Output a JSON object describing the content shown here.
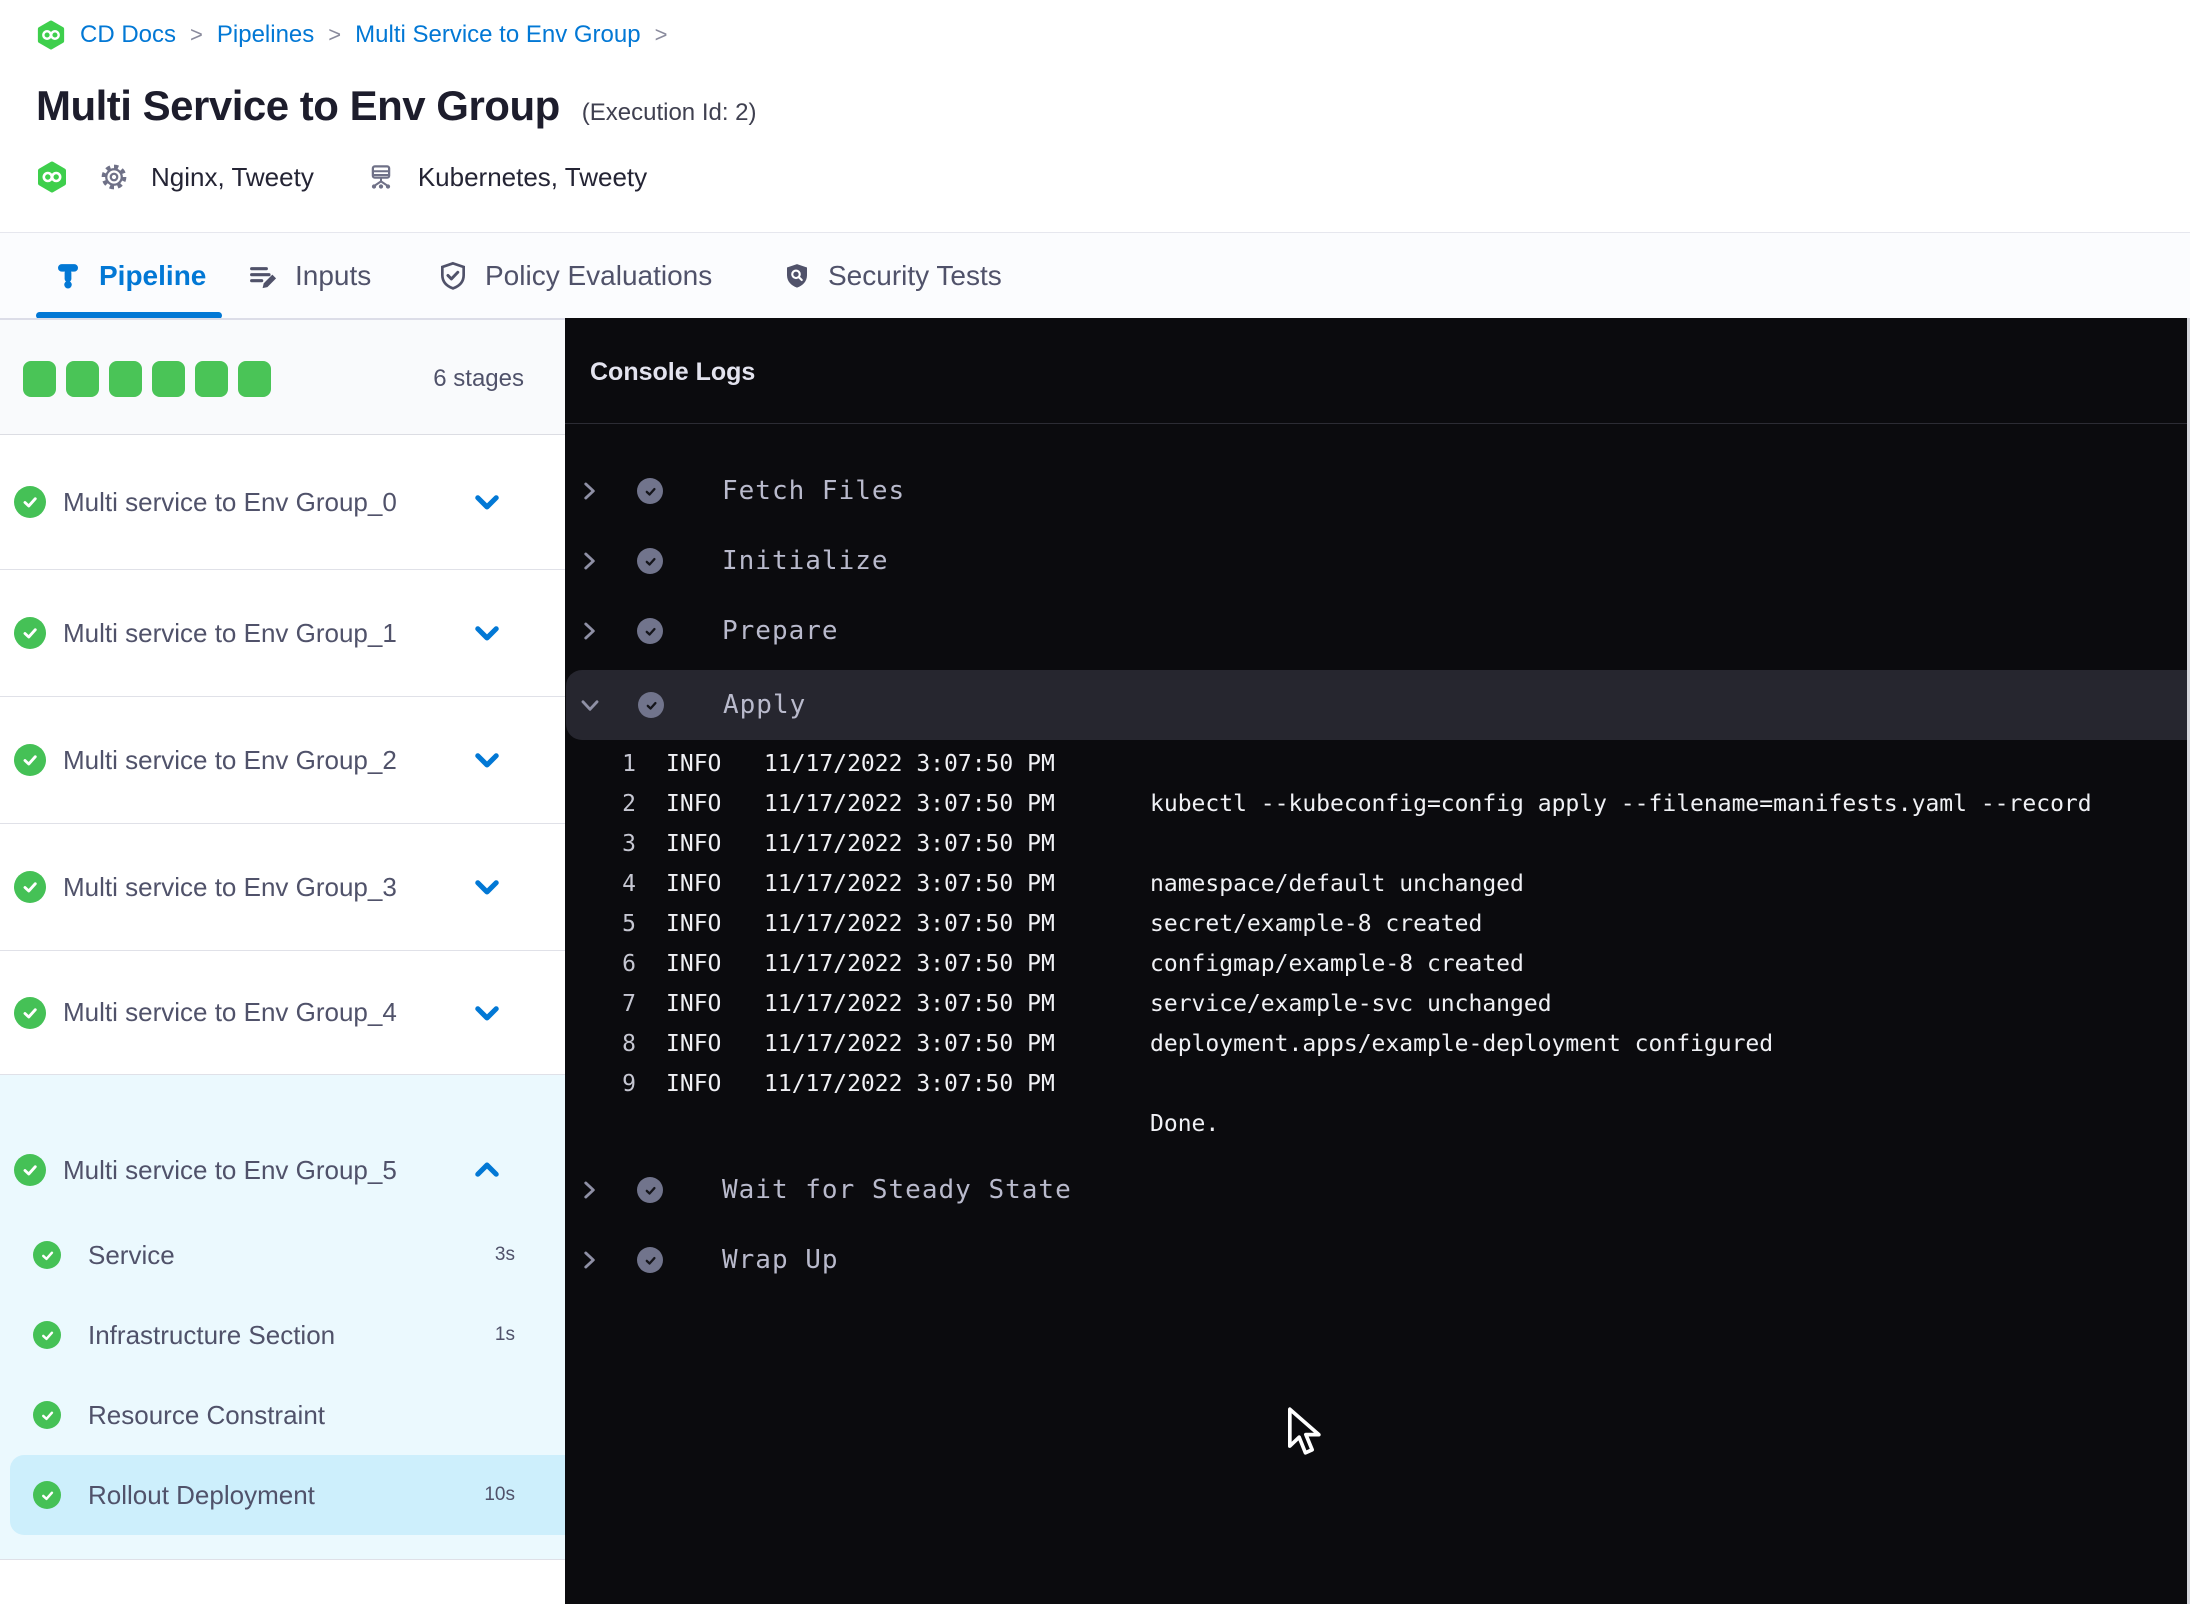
{
  "breadcrumb": {
    "separator": ">",
    "items": [
      {
        "label": "CD Docs"
      },
      {
        "label": "Pipelines"
      },
      {
        "label": "Multi Service to Env Group"
      }
    ]
  },
  "header": {
    "title": "Multi Service to Env Group",
    "execution_id": "(Execution Id: 2)",
    "services_label": "Nginx, Tweety",
    "environments_label": "Kubernetes, Tweety"
  },
  "tabs": [
    {
      "label": "Pipeline",
      "active": true
    },
    {
      "label": "Inputs",
      "active": false
    },
    {
      "label": "Policy Evaluations",
      "active": false
    },
    {
      "label": "Security Tests",
      "active": false
    }
  ],
  "stages": {
    "count_label": "6 stages",
    "items": [
      {
        "label": "Multi service to Env Group_0",
        "status": "success",
        "expanded": false
      },
      {
        "label": "Multi service to Env Group_1",
        "status": "success",
        "expanded": false
      },
      {
        "label": "Multi service to Env Group_2",
        "status": "success",
        "expanded": false
      },
      {
        "label": "Multi service to Env Group_3",
        "status": "success",
        "expanded": false
      },
      {
        "label": "Multi service to Env Group_4",
        "status": "success",
        "expanded": false
      },
      {
        "label": "Multi service to Env Group_5",
        "status": "success",
        "expanded": true
      }
    ],
    "expanded_steps": [
      {
        "label": "Service",
        "duration": "3s",
        "status": "success",
        "selected": false
      },
      {
        "label": "Infrastructure Section",
        "duration": "1s",
        "status": "success",
        "selected": false
      },
      {
        "label": "Resource Constraint",
        "duration": "",
        "status": "success",
        "selected": false
      },
      {
        "label": "Rollout Deployment",
        "duration": "10s",
        "status": "success",
        "selected": true
      }
    ]
  },
  "console": {
    "title": "Console Logs",
    "steps": [
      {
        "label": "Fetch Files",
        "status": "success",
        "expanded": false
      },
      {
        "label": "Initialize",
        "status": "success",
        "expanded": false
      },
      {
        "label": "Prepare",
        "status": "success",
        "expanded": false
      },
      {
        "label": "Apply",
        "status": "success",
        "expanded": true
      },
      {
        "label": "Wait for Steady State",
        "status": "success",
        "expanded": false
      },
      {
        "label": "Wrap Up",
        "status": "success",
        "expanded": false
      }
    ],
    "logs": [
      {
        "num": "1",
        "level": "INFO",
        "time": "11/17/2022 3:07:50 PM",
        "msg": ""
      },
      {
        "num": "2",
        "level": "INFO",
        "time": "11/17/2022 3:07:50 PM",
        "msg": "kubectl --kubeconfig=config apply --filename=manifests.yaml --record"
      },
      {
        "num": "3",
        "level": "INFO",
        "time": "11/17/2022 3:07:50 PM",
        "msg": ""
      },
      {
        "num": "4",
        "level": "INFO",
        "time": "11/17/2022 3:07:50 PM",
        "msg": "namespace/default unchanged"
      },
      {
        "num": "5",
        "level": "INFO",
        "time": "11/17/2022 3:07:50 PM",
        "msg": "secret/example-8 created"
      },
      {
        "num": "6",
        "level": "INFO",
        "time": "11/17/2022 3:07:50 PM",
        "msg": "configmap/example-8 created"
      },
      {
        "num": "7",
        "level": "INFO",
        "time": "11/17/2022 3:07:50 PM",
        "msg": "service/example-svc unchanged"
      },
      {
        "num": "8",
        "level": "INFO",
        "time": "11/17/2022 3:07:50 PM",
        "msg": "deployment.apps/example-deployment configured"
      },
      {
        "num": "9",
        "level": "INFO",
        "time": "11/17/2022 3:07:50 PM",
        "msg": ""
      },
      {
        "num": "",
        "level": "",
        "time": "",
        "msg": "Done."
      }
    ]
  },
  "icons": {
    "harness-logo": "green hexagon with white infinity",
    "gear-icon": "cog outline",
    "environment-icon": "database rack with legs",
    "pipeline-icon": "plumb pipeline glyph",
    "inputs-icon": "list lines with pencil",
    "policy-icon": "shield outline with check",
    "security-icon": "filled shield with magnifier",
    "check-circle-icon": "circle with check",
    "chevron-down-icon": "v",
    "chevron-up-icon": "^",
    "chevron-right-icon": ">"
  },
  "colors": {
    "accent_blue": "#0278d5",
    "success_green": "#4ac457",
    "console_bg": "#0b0b0e",
    "console_highlight": "#26262f",
    "expanded_bg": "#ebf9fe",
    "selected_step_bg": "#cdeffc",
    "slate_text": "#50526a"
  }
}
